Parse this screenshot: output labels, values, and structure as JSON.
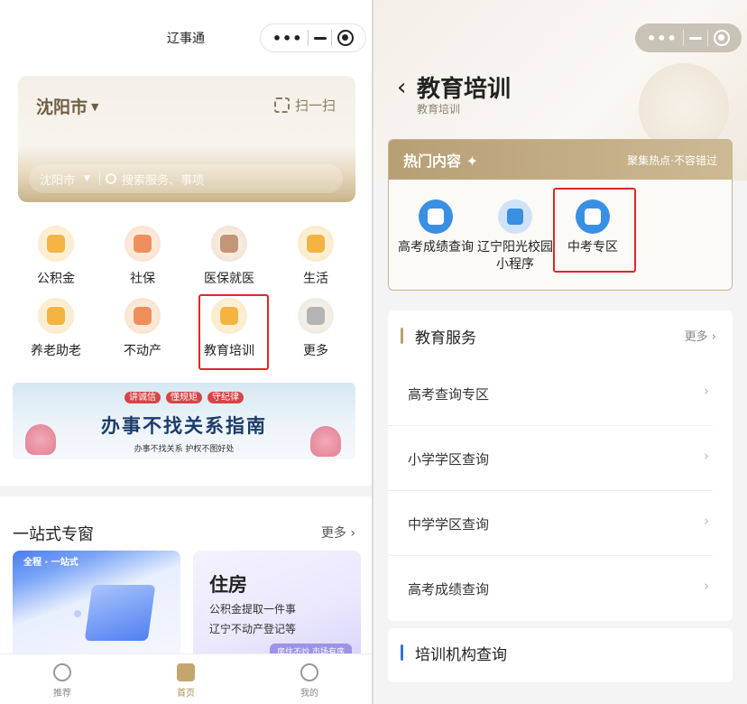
{
  "left": {
    "app_title": "辽事通",
    "city": "沈阳市",
    "scan_label": "扫一扫",
    "search": {
      "city": "沈阳市",
      "placeholder": "搜索服务、事项"
    },
    "grid": [
      {
        "label": "公积金",
        "icon": "gongjijin-icon",
        "color": "#f5b544"
      },
      {
        "label": "社保",
        "icon": "shebao-icon",
        "color": "#f08f5e"
      },
      {
        "label": "医保就医",
        "icon": "yibao-icon",
        "color": "#c39678"
      },
      {
        "label": "生活",
        "icon": "shenghuo-icon",
        "color": "#f2b341"
      },
      {
        "label": "养老助老",
        "icon": "yanglao-icon",
        "color": "#f2b341"
      },
      {
        "label": "不动产",
        "icon": "budongchan-icon",
        "color": "#ef8f5a"
      },
      {
        "label": "教育培训",
        "icon": "jiaoyu-icon",
        "color": "#f2b341"
      },
      {
        "label": "更多",
        "icon": "more-grid-icon",
        "color": "#b4b4b4"
      }
    ],
    "banner": {
      "tags": [
        "讲诚信",
        "懂规矩",
        "守纪律"
      ],
      "main": "办事不找关系指南",
      "sub": "办事不找关系   护权不图好处"
    },
    "section": {
      "title": "一站式专窗",
      "more": "更多"
    },
    "card1": {
      "tag": "全程 · 一站式"
    },
    "card2": {
      "title": "住房",
      "line1": "公积金提取一件事",
      "line2": "辽宁不动产登记等",
      "badge": "房住不炒 市场有序"
    },
    "tabs": [
      {
        "label": "推荐",
        "icon": "recommend-icon"
      },
      {
        "label": "首页",
        "icon": "home-icon"
      },
      {
        "label": "我的",
        "icon": "profile-icon"
      }
    ]
  },
  "right": {
    "title": "教育培训",
    "subtitle": "教育培训",
    "hot": {
      "title": "热门内容",
      "slogan": "聚集热点·不容错过",
      "items": [
        {
          "label": "高考成绩查询",
          "icon": "gaokao-score-icon",
          "color": "#3a8fe3"
        },
        {
          "label": "辽宁阳光校园小程序",
          "icon": "sunshine-campus-icon",
          "color": "#cfe3f8"
        },
        {
          "label": "中考专区",
          "icon": "zhongkao-icon",
          "color": "#3a8fe3"
        }
      ]
    },
    "service": {
      "title": "教育服务",
      "more": "更多",
      "items": [
        "高考查询专区",
        "小学学区查询",
        "中学学区查询",
        "高考成绩查询"
      ]
    },
    "training": {
      "title": "培训机构查询"
    }
  },
  "colors": {
    "gold": "#b79f74",
    "highlight": "#e0262b",
    "accent_gold": "#b79f74",
    "accent_blue": "#3b6fd8"
  }
}
